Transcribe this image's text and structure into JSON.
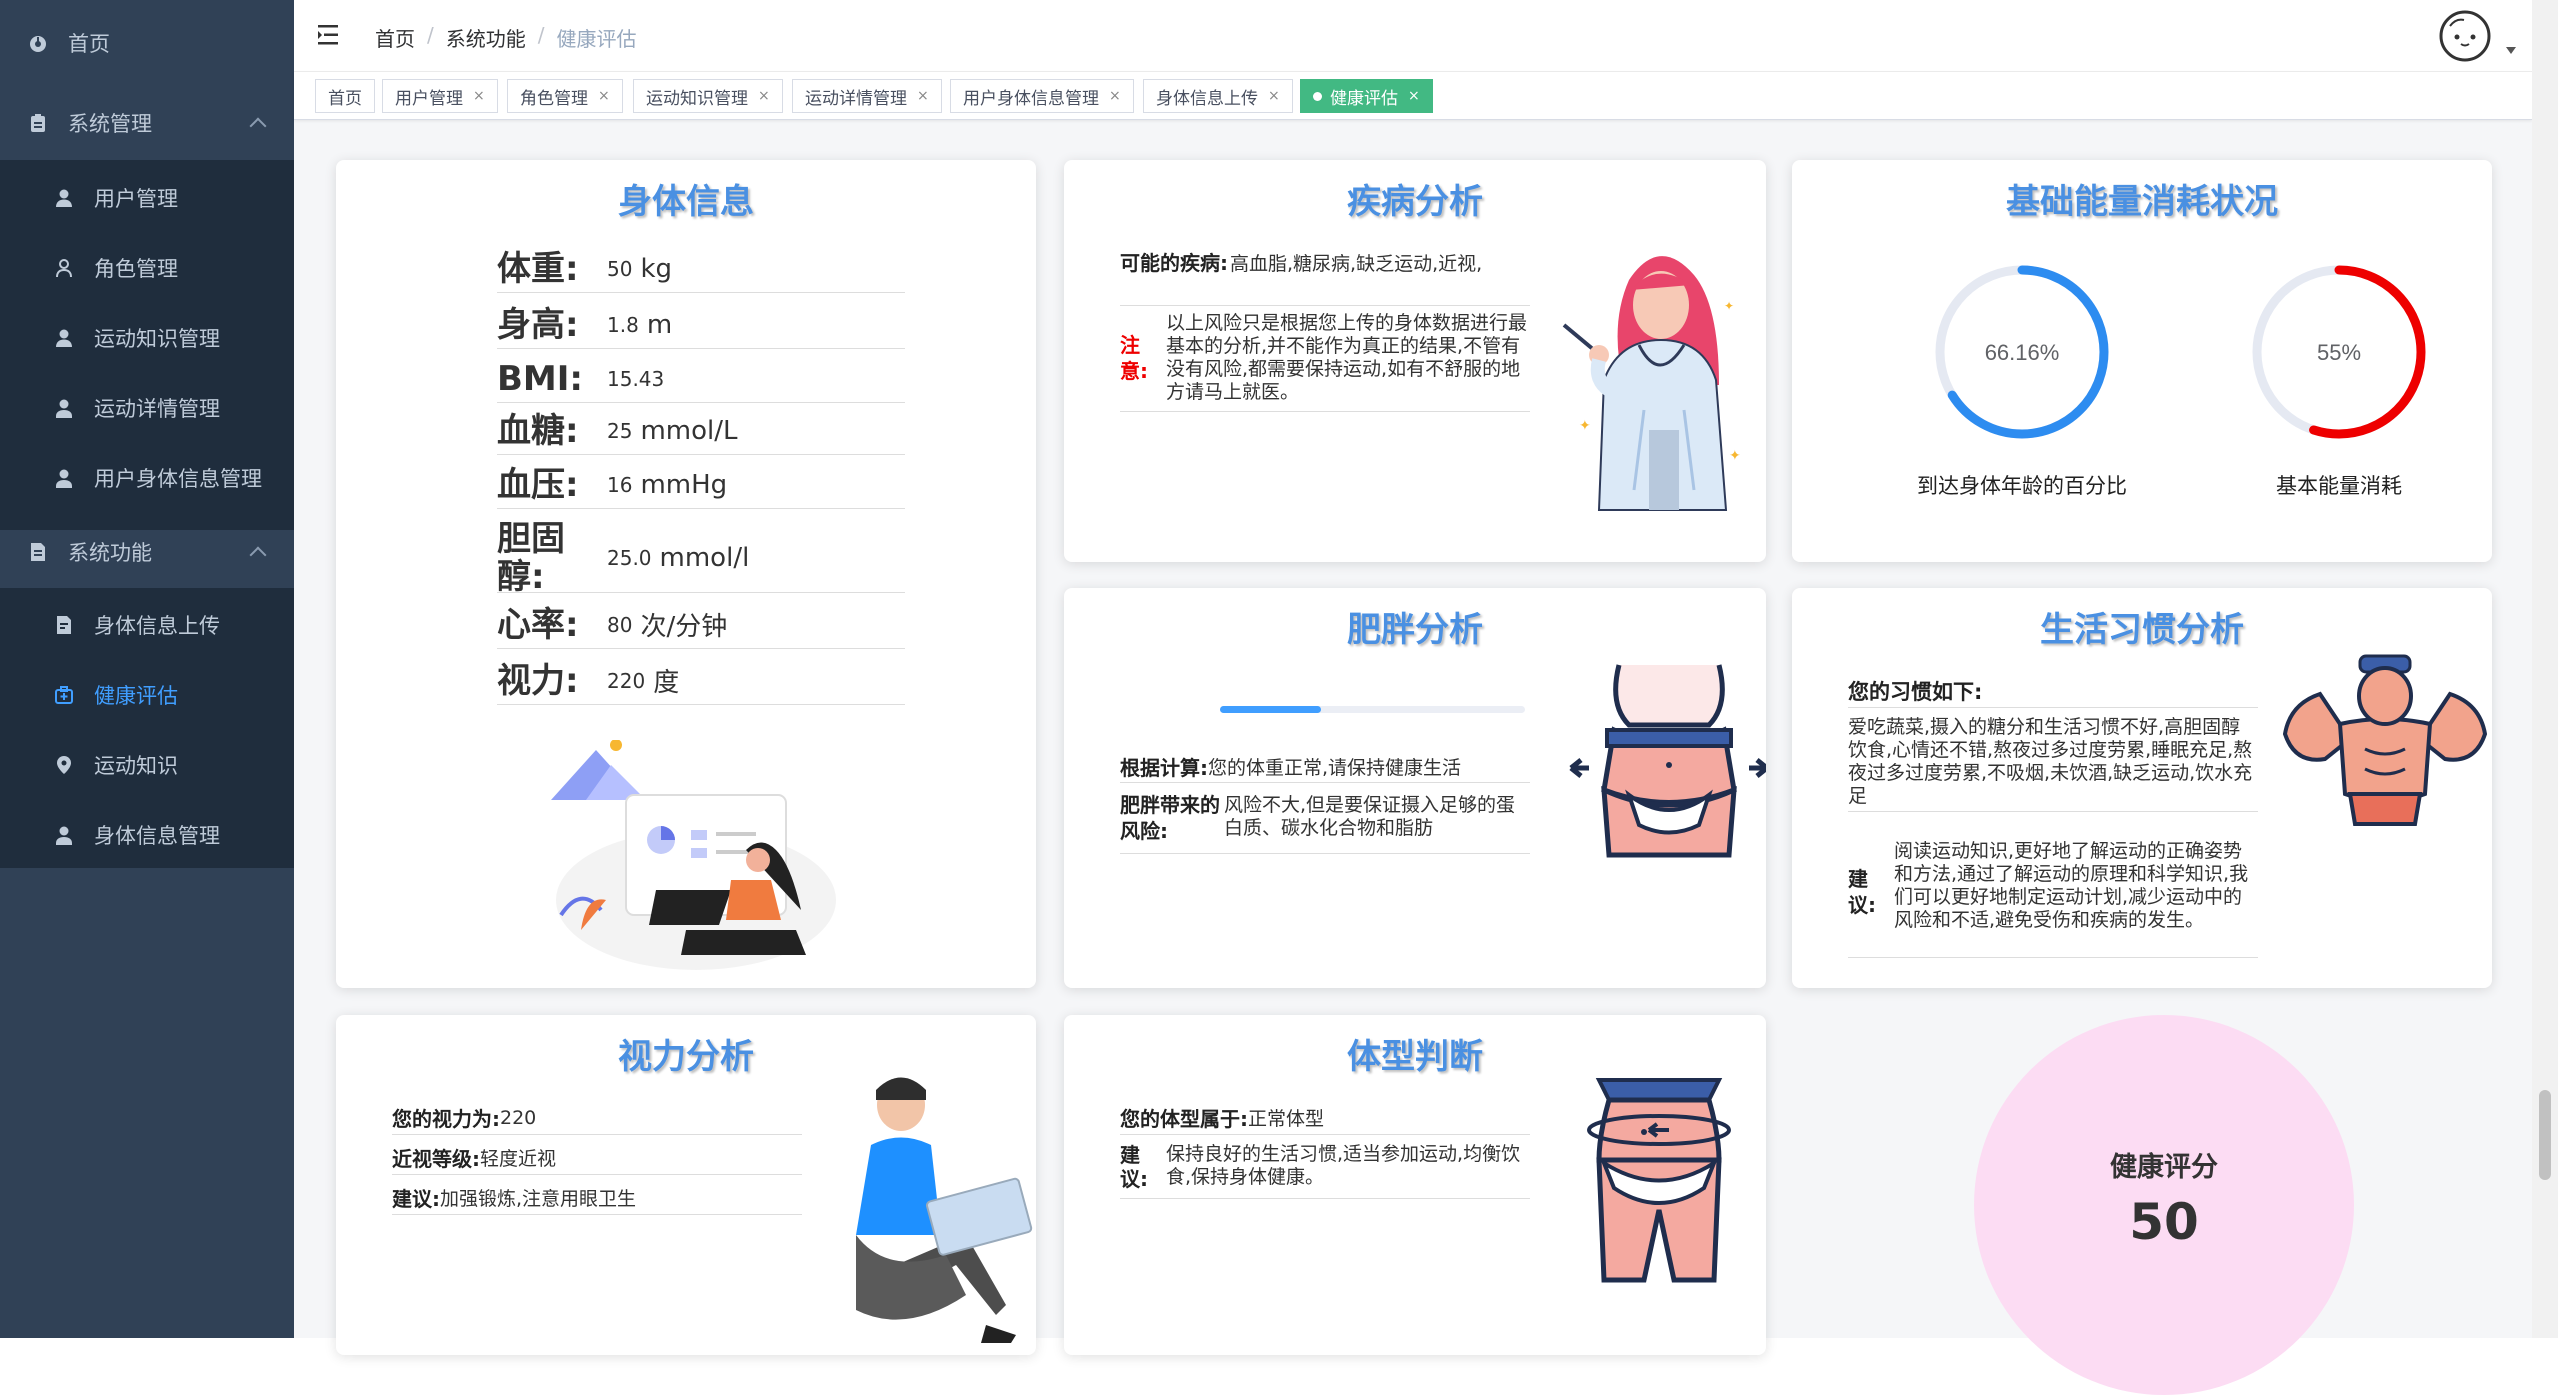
{
  "sidebar": {
    "home": "首页",
    "system_mgmt": "系统管理",
    "user_mgmt": "用户管理",
    "role_mgmt": "角色管理",
    "sport_knowledge_mgmt": "运动知识管理",
    "sport_detail_mgmt": "运动详情管理",
    "user_body_info_mgmt": "用户身体信息管理",
    "system_func": "系统功能",
    "body_upload": "身体信息上传",
    "health_eval": "健康评估",
    "sport_knowledge": "运动知识",
    "body_info_mgmt": "身体信息管理"
  },
  "breadcrumb": {
    "home": "首页",
    "sep": "/",
    "parent": "系统功能",
    "current": "健康评估"
  },
  "tags": [
    {
      "label": "首页",
      "closable": false
    },
    {
      "label": "用户管理",
      "closable": true
    },
    {
      "label": "角色管理",
      "closable": true
    },
    {
      "label": "运动知识管理",
      "closable": true
    },
    {
      "label": "运动详情管理",
      "closable": true
    },
    {
      "label": "用户身体信息管理",
      "closable": true
    },
    {
      "label": "身体信息上传",
      "closable": true
    },
    {
      "label": "健康评估",
      "closable": true,
      "active": true
    }
  ],
  "tag_close": "×",
  "body": {
    "title": "身体信息",
    "rows": [
      {
        "label": "体重:",
        "value": "50",
        "unit": "kg"
      },
      {
        "label": "身高:",
        "value": "1.8",
        "unit": "m"
      },
      {
        "label": "BMI:",
        "value": "15.43",
        "unit": ""
      },
      {
        "label": "血糖:",
        "value": "25",
        "unit": "mmol/L"
      },
      {
        "label": "血压:",
        "value": "16",
        "unit": "mmHg"
      },
      {
        "label": "胆固醇:",
        "value": "25.0",
        "unit": "mmol/l"
      },
      {
        "label": "心率:",
        "value": "80",
        "unit": "次/分钟"
      },
      {
        "label": "视力:",
        "value": "220",
        "unit": "度"
      }
    ]
  },
  "disease": {
    "title": "疾病分析",
    "possible_label": "可能的疾病:",
    "possible_value": "高血脂,糖尿病,缺乏运动,近视,",
    "note_label": "注意:",
    "note_value": "以上风险只是根据您上传的身体数据进行最基本的分析,并不能作为真正的结果,不管有没有风险,都需要保持运动,如有不舒服的地方请马上就医。"
  },
  "energy": {
    "title": "基础能量消耗状况",
    "ring1": {
      "text": "66.16%",
      "value": 66.16,
      "caption": "到达身体年龄的百分比",
      "color": "#2d8cf0"
    },
    "ring2": {
      "text": "55%",
      "value": 55,
      "caption": "基本能量消耗",
      "color": "#e00"
    }
  },
  "obesity": {
    "title": "肥胖分析",
    "progress": 0.33,
    "calc_label": "根据计算:",
    "calc_value": "您的体重正常,请保持健康生活",
    "risk_label": "肥胖带来的风险:",
    "risk_value": "风险不大,但是要保证摄入足够的蛋白质、碳水化合物和脂肪"
  },
  "habit": {
    "title": "生活习惯分析",
    "habit_label": "您的习惯如下:",
    "habit_value": "爱吃蔬菜,摄入的糖分和生活习惯不好,高胆固醇饮食,心情还不错,熬夜过多过度劳累,睡眠充足,熬夜过多过度劳累,不吸烟,未饮酒,缺乏运动,饮水充足",
    "suggest_label": "建议:",
    "suggest_value": "阅读运动知识,更好地了解运动的正确姿势和方法,通过了解运动的原理和科学知识,我们可以更好地制定运动计划,减少运动中的风险和不适,避免受伤和疾病的发生。"
  },
  "vision": {
    "title": "视力分析",
    "rows": [
      {
        "label": "您的视力为:",
        "value": "220"
      },
      {
        "label": "近视等级:",
        "value": "轻度近视"
      },
      {
        "label": "建议:",
        "value": "加强锻炼,注意用眼卫生"
      }
    ]
  },
  "bodytype": {
    "title": "体型判断",
    "type_label": "您的体型属于:",
    "type_value": "正常体型",
    "suggest_label": "建议:",
    "suggest_value": "保持良好的生活习惯,适当参加运动,均衡饮食,保持身体健康。"
  },
  "score": {
    "label": "健康评分",
    "value": "50"
  },
  "colors": {
    "sidebar": "#304156",
    "submenu": "#1f2d3d",
    "active_menu": "#409eff",
    "accent": "#42b983",
    "title": "#4a90e2"
  },
  "icons": [
    "dashboard-icon",
    "clipboard-icon",
    "user-icon",
    "user-outline-icon",
    "doc-icon",
    "upload-icon",
    "medkit-icon",
    "pin-icon",
    "menu-toggle-icon",
    "avatar-icon"
  ]
}
